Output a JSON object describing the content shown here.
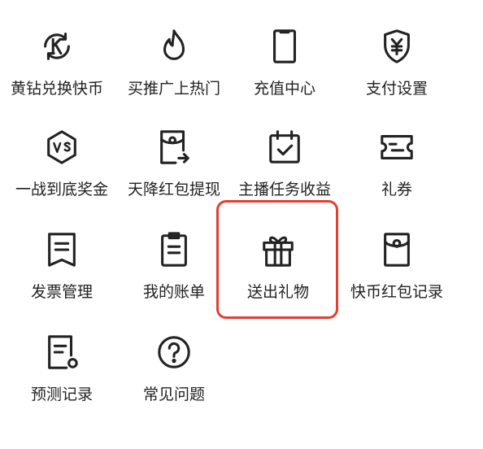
{
  "menu": {
    "items": [
      {
        "label": "黄钻兑换快币",
        "icon": "k-coin-exchange-icon"
      },
      {
        "label": "买推广上热门",
        "icon": "flame-icon"
      },
      {
        "label": "充值中心",
        "icon": "phone-recharge-icon"
      },
      {
        "label": "支付设置",
        "icon": "yuan-shield-icon"
      },
      {
        "label": "一战到底奖金",
        "icon": "vs-hexagon-icon"
      },
      {
        "label": "天降红包提现",
        "icon": "red-envelope-withdraw-icon"
      },
      {
        "label": "主播任务收益",
        "icon": "calendar-check-icon"
      },
      {
        "label": "礼券",
        "icon": "ticket-icon"
      },
      {
        "label": "发票管理",
        "icon": "invoice-icon"
      },
      {
        "label": "我的账单",
        "icon": "clipboard-bill-icon"
      },
      {
        "label": "送出礼物",
        "icon": "gift-icon"
      },
      {
        "label": "快币红包记录",
        "icon": "red-envelope-icon"
      },
      {
        "label": "预测记录",
        "icon": "prediction-record-icon"
      },
      {
        "label": "常见问题",
        "icon": "question-circle-icon"
      }
    ],
    "highlighted_label": "送出礼物",
    "highlight_color": "#e04032",
    "icon_color": "#222222"
  }
}
